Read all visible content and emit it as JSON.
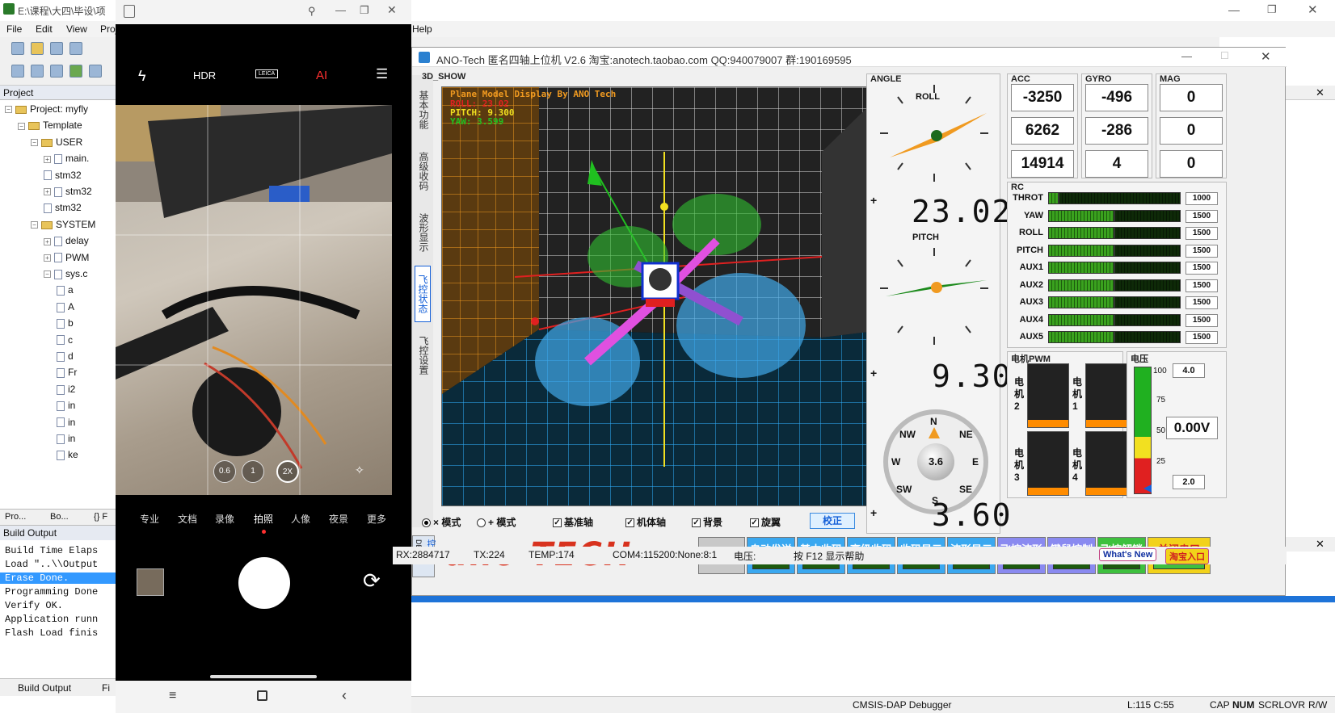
{
  "ide": {
    "title": "E:\\课程\\大四\\毕设\\项",
    "menu": [
      "File",
      "Edit",
      "View",
      "Proj",
      "Help"
    ],
    "project_panel_title": "Project",
    "tree": [
      {
        "label": "Project: myfly",
        "indent": 0
      },
      {
        "label": "Template",
        "indent": 1
      },
      {
        "label": "USER",
        "indent": 2
      },
      {
        "label": "main.",
        "indent": 3
      },
      {
        "label": "stm32",
        "indent": 3
      },
      {
        "label": "stm32",
        "indent": 3
      },
      {
        "label": "stm32",
        "indent": 3
      },
      {
        "label": "SYSTEM",
        "indent": 2
      },
      {
        "label": "delay",
        "indent": 3
      },
      {
        "label": "PWM",
        "indent": 3
      },
      {
        "label": "sys.c",
        "indent": 3
      },
      {
        "label": "a",
        "indent": 4
      },
      {
        "label": "A",
        "indent": 4
      },
      {
        "label": "b",
        "indent": 4
      },
      {
        "label": "c",
        "indent": 4
      },
      {
        "label": "d",
        "indent": 4
      },
      {
        "label": "Fr",
        "indent": 4
      },
      {
        "label": "i2",
        "indent": 4
      },
      {
        "label": "in",
        "indent": 4
      },
      {
        "label": "in",
        "indent": 4
      },
      {
        "label": "in",
        "indent": 4
      },
      {
        "label": "ke",
        "indent": 4
      }
    ],
    "proj_tabs": [
      "Pro...",
      "Bo...",
      "{} F"
    ],
    "build_output_title": "Build Output",
    "build_lines": [
      "Build Time Elaps",
      "Load \"..\\\\Output",
      "Erase Done.",
      "Programming Done",
      "Verify OK.",
      "Application runn",
      "Flash Load finis"
    ],
    "build_tabs": [
      "Build Output",
      "Fi"
    ],
    "status": {
      "debugger": "CMSIS-DAP Debugger",
      "pos": "L:115 C:55",
      "caps": "CAP",
      "num": "NUM",
      "scrl": "SCRL",
      "ovr": "OVR",
      "rw": "R/W"
    }
  },
  "phone": {
    "top_icons": [
      "flash-off-icon",
      "HDR",
      "LEICA",
      "AI",
      "menu-icon"
    ],
    "hdr": "HDR",
    "leica": "LEICA",
    "ai": "AI",
    "zoom": [
      "0.6",
      "1",
      "2X"
    ],
    "modes": [
      "专业",
      "文档",
      "录像",
      "拍照",
      "人像",
      "夜景",
      "更多"
    ]
  },
  "ano": {
    "title": "ANO-Tech  匿名四轴上位机   V2.6  淘宝:anotech.taobao.com  QQ:940079007  群:190169595",
    "side_tabs": [
      "基本功能",
      "高级收码",
      "波形显示",
      "飞控状态",
      "飞控设置"
    ],
    "view3d": {
      "title": "3D_SHOW",
      "overlay": "Plane Model Display By ANO Tech",
      "roll_label": "ROLL:",
      "roll": "23.02",
      "pitch_label": "PITCH:",
      "pitch": "9.300",
      "yaw_label": "YAW:",
      "yaw": "3.599"
    },
    "modes": {
      "x": "× 模式",
      "plus": "+ 模式",
      "axis": "基准轴",
      "body": "机体轴",
      "bg": "背景",
      "prop": "旋翼",
      "calib": "校正"
    },
    "angle": {
      "title": "ANGLE",
      "roll_label": "ROLL",
      "pitch_label": "PITCH",
      "roll": "23.02",
      "pitch": "9.30",
      "yaw": "3.60",
      "compass_value": "3.6",
      "compass": {
        "n": "N",
        "ne": "NE",
        "e": "E",
        "se": "SE",
        "s": "S",
        "sw": "SW",
        "w": "W",
        "nw": "NW"
      }
    },
    "acc": {
      "title": "ACC",
      "values": [
        "-3250",
        "6262",
        "14914"
      ]
    },
    "gyro": {
      "title": "GYRO",
      "values": [
        "-496",
        "-286",
        "4"
      ]
    },
    "mag": {
      "title": "MAG",
      "values": [
        "0",
        "0",
        "0"
      ]
    },
    "rc": {
      "title": "RC",
      "channels": [
        {
          "name": "THROT",
          "value": "1000",
          "level": 0.08
        },
        {
          "name": "YAW",
          "value": "1500",
          "level": 0.5
        },
        {
          "name": "ROLL",
          "value": "1500",
          "level": 0.5
        },
        {
          "name": "PITCH",
          "value": "1500",
          "level": 0.5
        },
        {
          "name": "AUX1",
          "value": "1500",
          "level": 0.5
        },
        {
          "name": "AUX2",
          "value": "1500",
          "level": 0.5
        },
        {
          "name": "AUX3",
          "value": "1500",
          "level": 0.5
        },
        {
          "name": "AUX4",
          "value": "1500",
          "level": 0.5
        },
        {
          "name": "AUX5",
          "value": "1500",
          "level": 0.5
        }
      ]
    },
    "motor": {
      "title": "电机PWM",
      "motors": [
        {
          "label": "电机2",
          "level": 0.12
        },
        {
          "label": "电机1",
          "level": 0.12
        },
        {
          "label": "电机3",
          "level": 0.12
        },
        {
          "label": "电机4",
          "level": 0.12
        }
      ]
    },
    "voltage": {
      "title": "电压",
      "ticks": [
        "100",
        "75",
        "50",
        "25"
      ],
      "max": "4.0",
      "value": "0.00V",
      "min": "2.0"
    },
    "debug_tab": {
      "a": "DBUG",
      "b": "控制"
    },
    "logo": "ano TECH",
    "buttons": [
      {
        "label": "清除",
        "color": "#c8c8c8"
      },
      {
        "label": "自动发送",
        "color": "#3aa8f0"
      },
      {
        "label": "基本收码",
        "color": "#3aa8f0"
      },
      {
        "label": "高级收码",
        "color": "#3aa8f0"
      },
      {
        "label": "收码显示",
        "color": "#3aa8f0"
      },
      {
        "label": "波形显示",
        "color": "#3aa8f0"
      },
      {
        "label": "飞控波形",
        "color": "#8a8af0"
      },
      {
        "label": "键鼠控制",
        "color": "#8a8af0"
      },
      {
        "label": "飞控解锁",
        "color": "#3ec03e"
      },
      {
        "label": "关闭串口",
        "color": "#f2d21a"
      }
    ],
    "statusbar": {
      "rx": "RX:2884717",
      "tx": "TX:224",
      "temp": "TEMP:174",
      "com": "COM4:115200:None:8:1",
      "volt": "电压:",
      "help": "按 F12 显示帮助",
      "whats_new": "What's New",
      "shop": "淘宝入口"
    }
  }
}
